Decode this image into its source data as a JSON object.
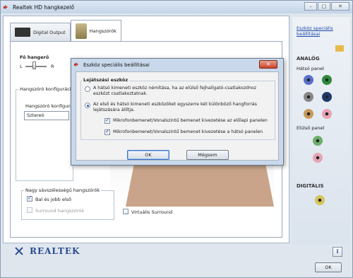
{
  "window": {
    "title": "Realtek HD hangkezelő",
    "caption_buttons": [
      "–",
      "□",
      "✕"
    ]
  },
  "tabs": [
    {
      "label": "Digital Output",
      "active": false
    },
    {
      "label": "Hangszórók",
      "active": true
    }
  ],
  "main": {
    "main_volume_label": "Fő hangerő",
    "balance_left": "L",
    "balance_right": "R",
    "speaker_config_group": "Hangszóró konfiguráció",
    "speaker_config_label": "Hangszóró konfiguráció",
    "speaker_config_value": "Sztereó",
    "fullrange_group": "Nagy sávszélességű hangszórók",
    "front_lr": {
      "label": "Bal és jobb első",
      "checked": true
    },
    "surround": {
      "label": "Surround hangszórók",
      "checked": false,
      "disabled": true
    },
    "virtual_surround": {
      "label": "Virtuális Surround",
      "checked": false
    }
  },
  "sidebar": {
    "link": "Eszköz speciális beállításai",
    "analog_heading": "ANALÓG",
    "back_panel_label": "Hátsó panel",
    "front_panel_label": "Elülső panel",
    "digital_heading": "DIGITÁLIS",
    "back_jacks": [
      "#5a6fc9",
      "#2f8a3a",
      "#888888",
      "#1f3a6a",
      "#c79a5a",
      "#e7a4b4"
    ],
    "front_jacks": [
      "#6cae6c",
      "#e7a4b4"
    ],
    "digital_jack": "#d4c45a"
  },
  "footer": {
    "brand": "REALTEK",
    "info_label": "i",
    "ok_label": "OK"
  },
  "dialog": {
    "title": "Eszköz speciális beállításai",
    "close_label": "✕",
    "group_title": "Lejátszási eszköz",
    "option1": "A hátsó kimeneti eszköz némítása, ha az elülső fejhallgató-csatlakozóhoz eszközt csatlakoztatnak.",
    "option2": "Az első és hátsó kimeneti eszközöket egyszerre két különböző hangforrás lejátszására állítja.",
    "selected_option": 2,
    "mic_front": {
      "label": "Mikrofonbemenet/Vonalszintű bemenet kivezetése az előlapi panelen",
      "checked": true
    },
    "mic_back": {
      "label": "Mikrofonbemenet/Vonalszintű bemenet kivezetése a hátsó panelen",
      "checked": true
    },
    "ok_label": "OK",
    "cancel_label": "Mégsem"
  }
}
